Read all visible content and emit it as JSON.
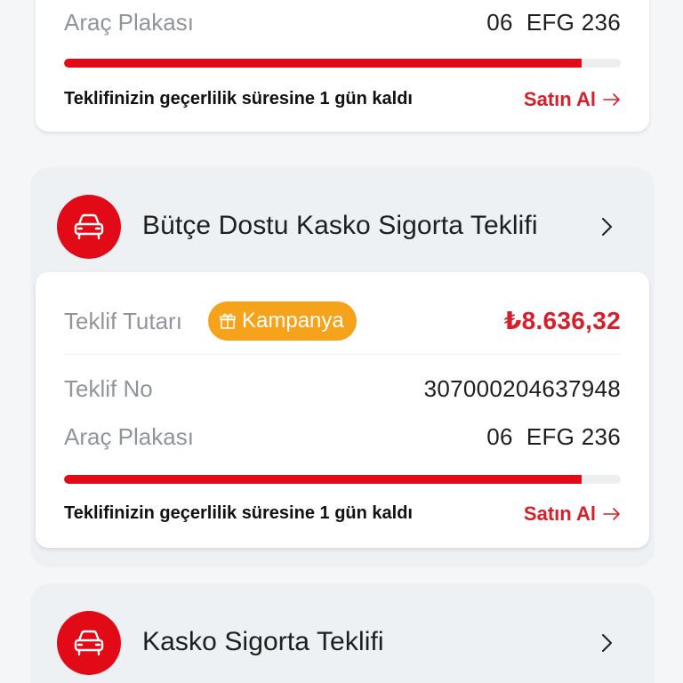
{
  "top_card": {
    "plate_label": "Araç Plakası",
    "plate_value": "06  EFG 236",
    "validity_progress": 0.93,
    "validity_note": "Teklifinizin geçerlilik süresine 1 gün kaldı",
    "buy_label": "Satın Al"
  },
  "offers": [
    {
      "title": "Bütçe Dostu Kasko Sigorta Teklifi",
      "amount_label": "Teklif Tutarı",
      "campaign_label": "Kampanya",
      "amount_value": "₺8.636,32",
      "offer_no_label": "Teklif No",
      "offer_no_value": "307000204637948",
      "plate_label": "Araç Plakası",
      "plate_value": "06  EFG 236",
      "validity_progress": 0.93,
      "validity_note": "Teklifinizin geçerlilik süresine 1 gün kaldı",
      "buy_label": "Satın Al"
    },
    {
      "title": "Kasko Sigorta Teklifi"
    }
  ],
  "colors": {
    "accent_red": "#e30a17",
    "price_red": "#d81e2a",
    "campaign_orange": "#f7a21b"
  },
  "icons": {
    "group_icon": "car-icon",
    "group_nav": "chevron-right-icon",
    "buy_icon": "arrow-right-icon",
    "campaign_icon": "gift-icon"
  }
}
